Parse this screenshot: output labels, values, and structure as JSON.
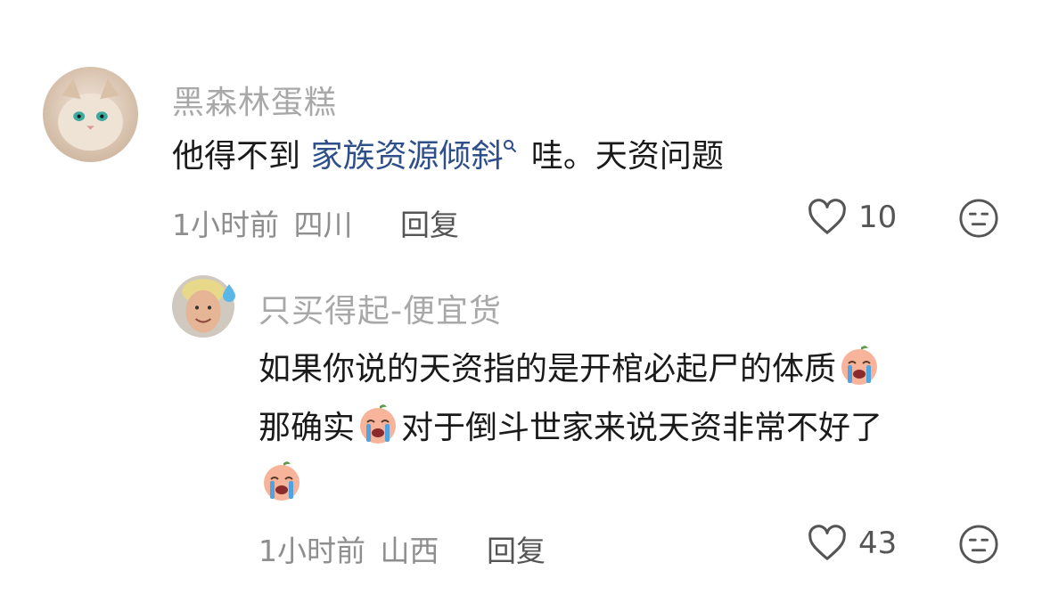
{
  "comment": {
    "username": "黑森林蛋糕",
    "text_before": "他得不到 ",
    "link_text": "家族资源倾斜",
    "text_after": " 哇。天资问题",
    "time": "1小时前",
    "location": "四川",
    "reply_label": "回复",
    "like_count": "10"
  },
  "reply": {
    "username": "只买得起-便宜货",
    "line1": "如果你说的天资指的是开棺必起尸的体质",
    "line2_a": "那确实",
    "line2_b": "对于倒斗世家来说天资非常不好了",
    "time": "1小时前",
    "location": "山西",
    "reply_label": "回复",
    "like_count": "43"
  },
  "icons": {
    "like": "heart-outline-icon",
    "dislike": "neutral-face-icon",
    "emoji": "crying-peach-emoji",
    "search": "search-icon"
  },
  "colors": {
    "username": "#a8a8a8",
    "link": "#2e4f8a",
    "meta": "#8e8e8e"
  }
}
